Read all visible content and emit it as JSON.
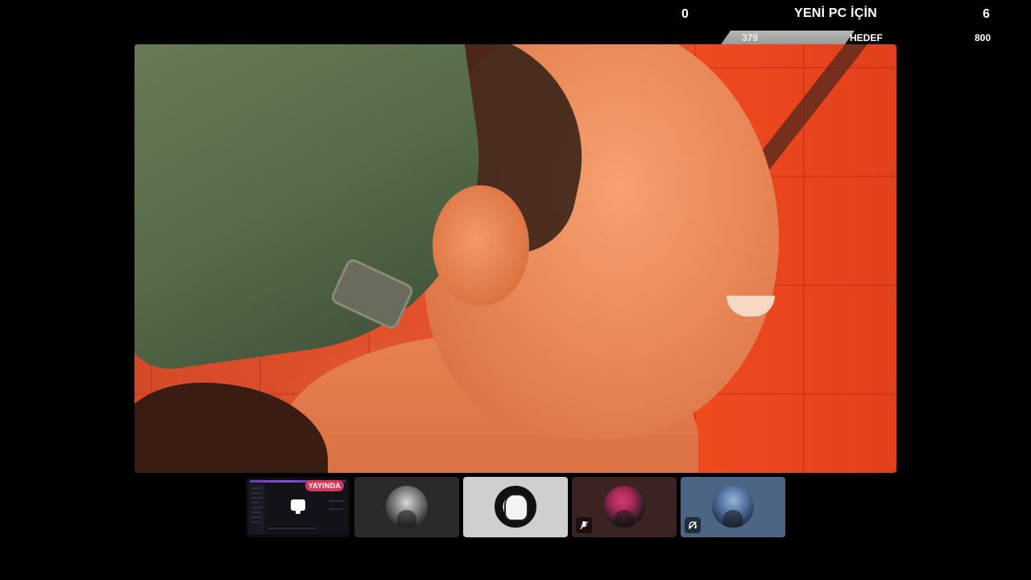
{
  "goal": {
    "left_count": "0",
    "title": "YENİ PC İÇİN",
    "right_count": "6",
    "current": "379",
    "label": "HEDEF",
    "target": "800",
    "progress_fraction": 0.474
  },
  "main_stream": {
    "icon": "video-feed"
  },
  "participants": [
    {
      "type": "screen-share",
      "badge": "YAYINDA",
      "icon": "monitor-icon"
    },
    {
      "type": "user",
      "avatar": "avatar-hooded"
    },
    {
      "type": "user",
      "avatar": "avatar-manga",
      "active": true
    },
    {
      "type": "user",
      "avatar": "avatar-pink-hair",
      "status_icon": "mic-off-icon"
    },
    {
      "type": "user",
      "avatar": "avatar-blue",
      "status_icon": "deafened-icon"
    }
  ],
  "colors": {
    "live_badge": "#d13a5a",
    "active_tile": "#cfcfcf",
    "tile_2": "#2a2a2a",
    "tile_4": "#3a2320",
    "tile_5": "#4d6585"
  }
}
